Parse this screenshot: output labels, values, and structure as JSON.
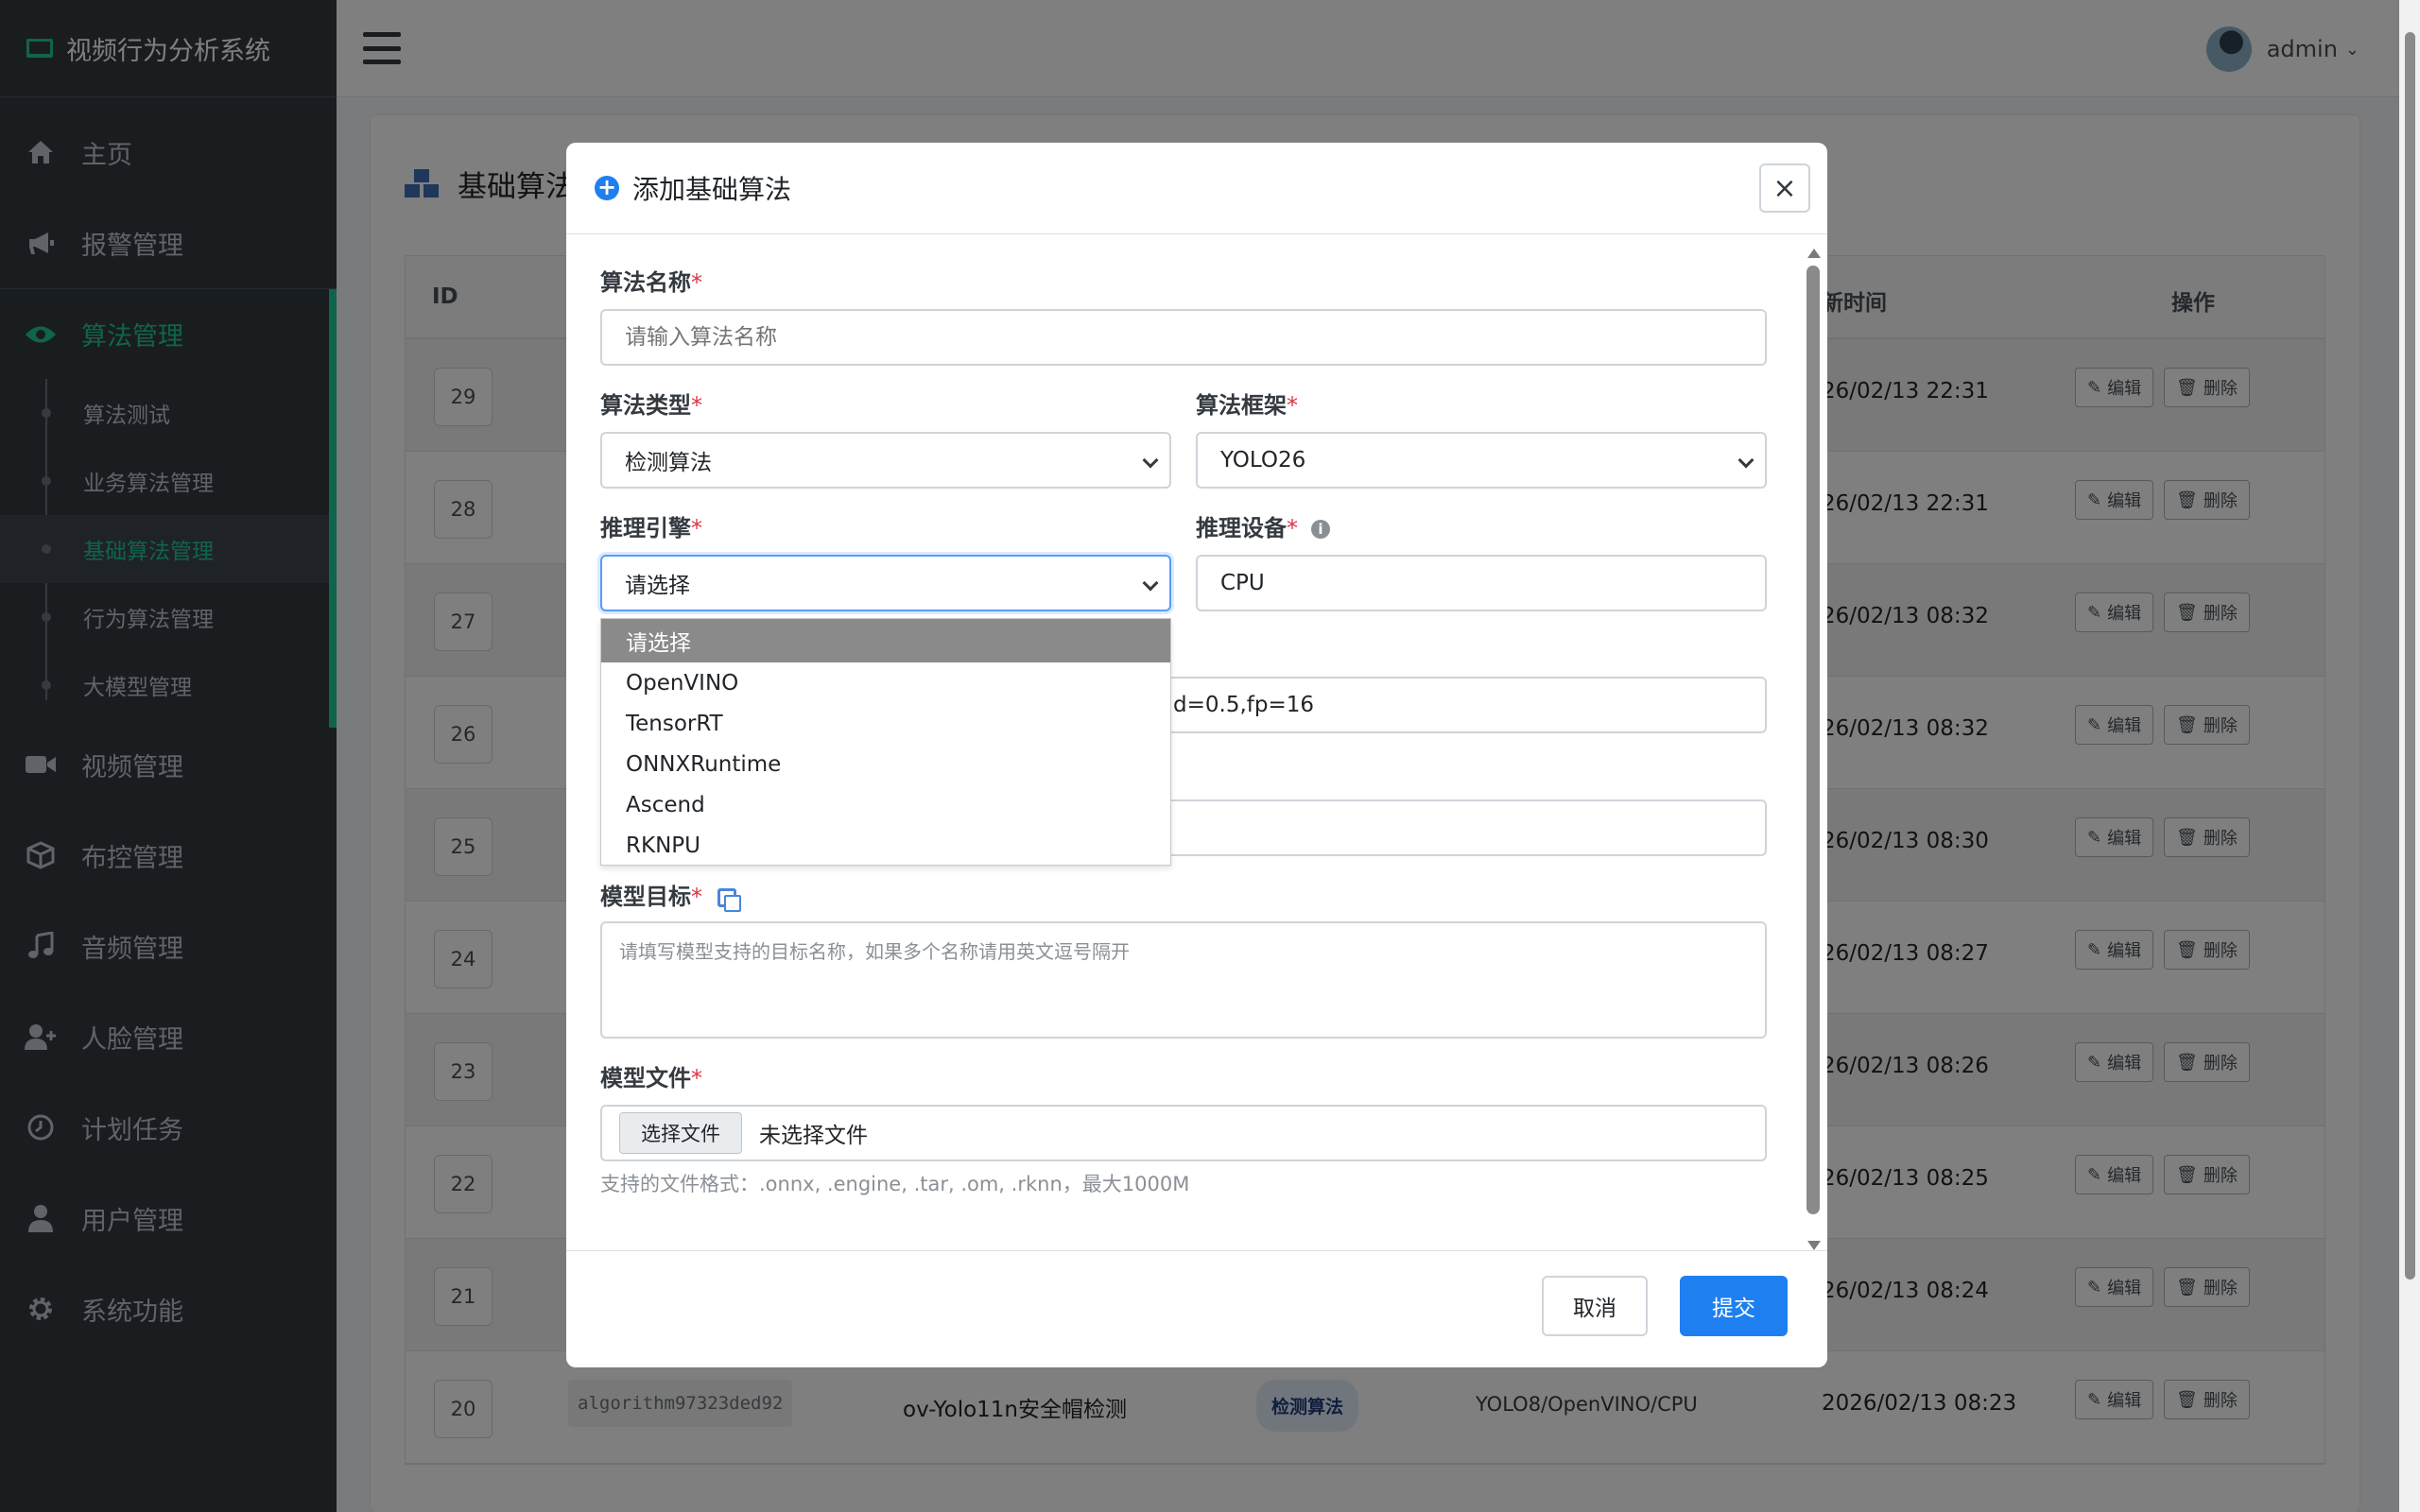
{
  "app": {
    "title": "视频行为分析系统"
  },
  "sidebar": {
    "items": [
      {
        "label": "主页",
        "icon": "home-icon"
      },
      {
        "label": "报警管理",
        "icon": "megaphone-icon"
      },
      {
        "label": "算法管理",
        "icon": "eye-icon",
        "active": true
      },
      {
        "label": "视频管理",
        "icon": "video-camera-icon"
      },
      {
        "label": "布控管理",
        "icon": "cube-icon"
      },
      {
        "label": "音频管理",
        "icon": "music-note-icon"
      },
      {
        "label": "人脸管理",
        "icon": "user-plus-icon"
      },
      {
        "label": "计划任务",
        "icon": "clock-icon"
      },
      {
        "label": "用户管理",
        "icon": "user-icon"
      },
      {
        "label": "系统功能",
        "icon": "gear-icon"
      }
    ],
    "sub_items": [
      {
        "label": "算法测试"
      },
      {
        "label": "业务算法管理"
      },
      {
        "label": "基础算法管理",
        "active": true
      },
      {
        "label": "行为算法管理"
      },
      {
        "label": "大模型管理"
      }
    ]
  },
  "topbar": {
    "username": "admin"
  },
  "page": {
    "title": "基础算法",
    "table": {
      "headers": {
        "id": "ID",
        "time": "新时间",
        "ops": "操作"
      },
      "edit_label": "编辑",
      "delete_label": "删除",
      "rows": [
        {
          "id": "29",
          "time": "26/02/13 22:31"
        },
        {
          "id": "28",
          "time": "26/02/13 22:31"
        },
        {
          "id": "27",
          "time": "26/02/13 08:32"
        },
        {
          "id": "26",
          "time": "26/02/13 08:32"
        },
        {
          "id": "25",
          "time": "26/02/13 08:30"
        },
        {
          "id": "24",
          "time": "26/02/13 08:27"
        },
        {
          "id": "23",
          "time": "26/02/13 08:26"
        },
        {
          "id": "22",
          "time": "26/02/13 08:25"
        },
        {
          "id": "21",
          "time": "26/02/13 08:24"
        },
        {
          "id": "20",
          "time": "2026/02/13 08:23",
          "code": "algorithm97323ded92",
          "name": "ov-Yolo11n安全帽检测",
          "type": "检测算法",
          "framework": "YOLO8/OpenVINO/CPU"
        }
      ]
    }
  },
  "modal": {
    "title": "添加基础算法",
    "close_label": "×",
    "fields": {
      "name": {
        "label": "算法名称",
        "placeholder": "请输入算法名称"
      },
      "type": {
        "label": "算法类型",
        "value": "检测算法"
      },
      "framework": {
        "label": "算法框架",
        "value": "YOLO26"
      },
      "engine": {
        "label": "推理引擎",
        "value": "请选择"
      },
      "device": {
        "label": "推理设备",
        "value": "CPU"
      },
      "params": {
        "value": "d=0.5,fp=16"
      },
      "target": {
        "label": "模型目标",
        "placeholder": "请填写模型支持的目标名称，如果多个名称请用英文逗号隔开"
      },
      "file": {
        "label": "模型文件",
        "button": "选择文件",
        "status": "未选择文件",
        "help": "支持的文件格式：.onnx, .engine, .tar, .om, .rknn，最大1000M"
      }
    },
    "required_mark": "*",
    "engine_options": [
      "请选择",
      "OpenVINO",
      "TensorRT",
      "ONNXRuntime",
      "Ascend",
      "RKNPU"
    ],
    "cancel_label": "取消",
    "submit_label": "提交"
  },
  "colors": {
    "accent": "#20c997",
    "primary": "#1e7ff0",
    "sidebar_bg": "#343a40",
    "required": "#dc3545"
  }
}
